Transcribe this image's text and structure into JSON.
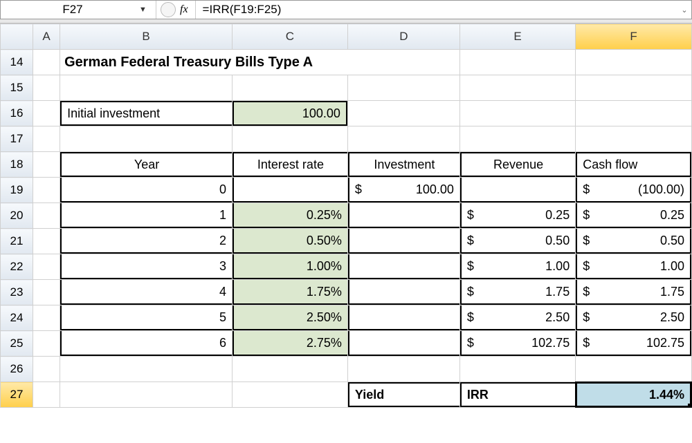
{
  "formula_bar": {
    "cell_ref": "F27",
    "fx_label": "fx",
    "formula": "=IRR(F19:F25)"
  },
  "columns": [
    "A",
    "B",
    "C",
    "D",
    "E",
    "F"
  ],
  "row_headers": [
    "14",
    "15",
    "16",
    "17",
    "18",
    "19",
    "20",
    "21",
    "22",
    "23",
    "24",
    "25",
    "26",
    "27"
  ],
  "active_col": "F",
  "active_row": "27",
  "title": "German Federal Treasury Bills Type A",
  "initial": {
    "label": "Initial investment",
    "value": "100.00"
  },
  "table_headers": {
    "year": "Year",
    "rate": "Interest rate",
    "investment": "Investment",
    "revenue": "Revenue",
    "cashflow": "Cash flow"
  },
  "rows": [
    {
      "year": "0",
      "rate": "",
      "investment": "100.00",
      "revenue": "",
      "cashflow": "(100.00)"
    },
    {
      "year": "1",
      "rate": "0.25%",
      "investment": "",
      "revenue": "0.25",
      "cashflow": "0.25"
    },
    {
      "year": "2",
      "rate": "0.50%",
      "investment": "",
      "revenue": "0.50",
      "cashflow": "0.50"
    },
    {
      "year": "3",
      "rate": "1.00%",
      "investment": "",
      "revenue": "1.00",
      "cashflow": "1.00"
    },
    {
      "year": "4",
      "rate": "1.75%",
      "investment": "",
      "revenue": "1.75",
      "cashflow": "1.75"
    },
    {
      "year": "5",
      "rate": "2.50%",
      "investment": "",
      "revenue": "2.50",
      "cashflow": "2.50"
    },
    {
      "year": "6",
      "rate": "2.75%",
      "investment": "",
      "revenue": "102.75",
      "cashflow": "102.75"
    }
  ],
  "yield_row": {
    "label": "Yield",
    "method": "IRR",
    "value": "1.44%"
  },
  "currency_symbol": "$"
}
